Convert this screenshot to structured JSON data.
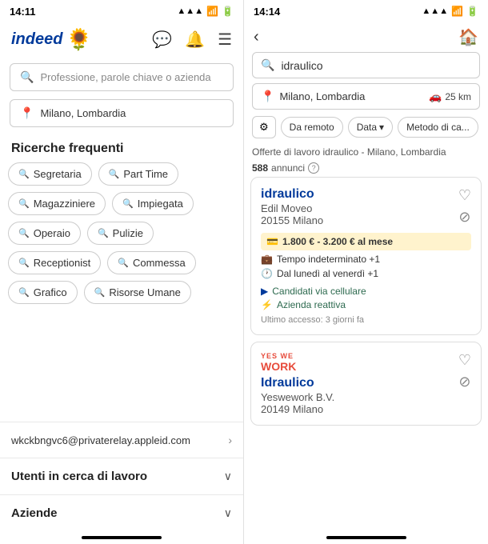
{
  "left": {
    "statusBar": {
      "time": "14:11"
    },
    "logo": {
      "text": "indeed",
      "sunflower": "🌻"
    },
    "search": {
      "placeholder": "Professione, parole chiave o azienda"
    },
    "location": {
      "text": "Milano, Lombardia"
    },
    "frequentTitle": "Ricerche frequenti",
    "chips": [
      "Segretaria",
      "Part Time",
      "Magazziniere",
      "Impiegata",
      "Operaio",
      "Pulizie",
      "Receptionist",
      "Commessa",
      "Grafico",
      "Risorse Umane"
    ],
    "account": {
      "email": "wkckbngvc6@privaterelay.appleid.com"
    },
    "accordions": [
      "Utenti in cerca di lavoro",
      "Aziende"
    ]
  },
  "right": {
    "statusBar": {
      "time": "14:14"
    },
    "searchQuery": "idraulico",
    "location": {
      "text": "Milano, Lombardia",
      "distance": "25 km"
    },
    "filters": [
      {
        "label": "Da remoto",
        "active": false
      },
      {
        "label": "Data",
        "active": false,
        "hasArrow": true
      },
      {
        "label": "Metodo di ca...",
        "active": false
      }
    ],
    "resultsInfo": {
      "prefix": "Offerte di lavoro idraulico - Milano, Lombardia",
      "count": "588",
      "countLabel": "annunci"
    },
    "jobs": [
      {
        "title": "idraulico",
        "company": "Edil Moveo",
        "location": "20155 Milano",
        "salary": "1.800 € - 3.200 € al mese",
        "badges": [
          {
            "icon": "💼",
            "text": "Tempo indeterminato +1"
          },
          {
            "icon": "🕐",
            "text": "Dal lunedì al venerdì +1"
          }
        ],
        "extras": [
          {
            "icon": "▶",
            "text": "Candidati via cellulare"
          },
          {
            "icon": "⚡",
            "text": "Azienda reattiva"
          }
        ],
        "lastAccess": "Ultimo accesso: 3 giorni fa"
      },
      {
        "title": "Idraulico",
        "company": "Yeswework B.V.",
        "location": "20149 Milano",
        "salary": "",
        "badges": [],
        "extras": [],
        "lastAccess": "",
        "hasYesWe": true
      }
    ]
  }
}
